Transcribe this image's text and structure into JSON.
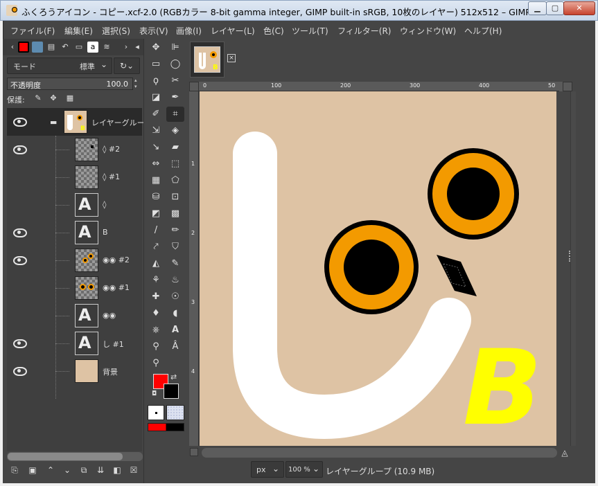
{
  "window": {
    "title": "ふくろうアイコン - コピー.xcf-2.0 (RGBカラー 8-bit gamma integer, GIMP built-in sRGB, 10枚のレイヤー) 512x512 – GIMP",
    "min_glyph": "▁",
    "max_glyph": "▢",
    "close_glyph": "✕"
  },
  "menu": [
    "ファイル(F)",
    "編集(E)",
    "選択(S)",
    "表示(V)",
    "画像(I)",
    "レイヤー(L)",
    "色(C)",
    "ツール(T)",
    "フィルター(R)",
    "ウィンドウ(W)",
    "ヘルプ(H)"
  ],
  "layers_panel": {
    "mode_label": "モード",
    "mode_value": "標準",
    "opacity_label": "不透明度",
    "opacity_value": "100.0",
    "opacity_fraction": 1.0,
    "lock_label": "保護:",
    "layers": [
      {
        "name": "レイヤーグループ",
        "visible": true,
        "thumb": "group",
        "selected": true
      },
      {
        "name": "◊ #2",
        "visible": true,
        "thumb": "checker"
      },
      {
        "name": "◊ #1",
        "visible": false,
        "thumb": "checker"
      },
      {
        "name": "◊",
        "visible": false,
        "thumb": "text"
      },
      {
        "name": "B",
        "visible": true,
        "thumb": "text"
      },
      {
        "name": "◉◉ #2",
        "visible": true,
        "thumb": "checker-eyes"
      },
      {
        "name": "◉◉ #1",
        "visible": false,
        "thumb": "checker-eyes"
      },
      {
        "name": "◉◉",
        "visible": false,
        "thumb": "text"
      },
      {
        "name": "し #1",
        "visible": true,
        "thumb": "text"
      },
      {
        "name": "背景",
        "visible": true,
        "thumb": "bg"
      }
    ],
    "text_thumb_glyph": "A"
  },
  "status": {
    "unit": "px",
    "zoom": "100 %",
    "text": "レイヤーグループ (10.9 MB)"
  },
  "rulers": {
    "h_labels": [
      "0",
      "100",
      "200",
      "300",
      "400",
      "50"
    ],
    "v_labels": [
      "1",
      "2",
      "3",
      "4"
    ]
  },
  "canvas": {
    "letter": "B",
    "colors": {
      "background": "#dec3a4",
      "ring": "#f39a00",
      "letter": "#ffff00",
      "stroke": "#ffffff"
    }
  },
  "colors": {
    "foreground": "#ff0000",
    "background_color": "#000000"
  }
}
